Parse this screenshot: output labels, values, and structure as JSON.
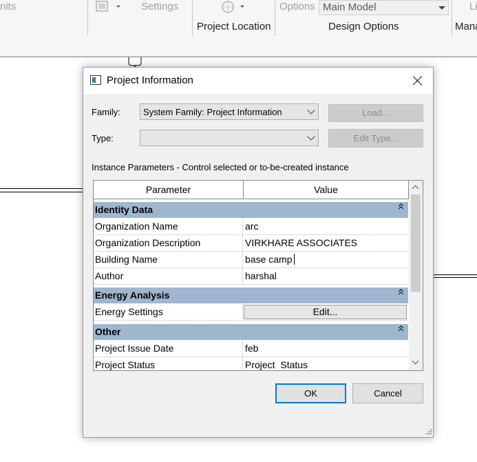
{
  "ribbon": {
    "units_fragment": "nits",
    "settings_label": "Settings",
    "options_label": "Options",
    "main_model_value": "Main Model",
    "fragment_right_top": "Li",
    "project_location_label": "Project Location",
    "design_options_label": "Design Options",
    "manage_fragment": "Mana"
  },
  "dialog": {
    "title": "Project Information",
    "family_label": "Family:",
    "family_value": "System Family: Project Information",
    "type_label": "Type:",
    "type_value": "",
    "load_button": "Load...",
    "edit_type_button": "Edit Type...",
    "instance_text": "Instance Parameters - Control selected or to-be-created instance",
    "grid": {
      "columns": [
        "Parameter",
        "Value"
      ],
      "groups": [
        {
          "name": "Identity Data",
          "rows": [
            {
              "param": "Organization Name",
              "value": "arc"
            },
            {
              "param": "Organization Description",
              "value": "VIRKHARE ASSOCIATES"
            },
            {
              "param": "Building Name",
              "value": "base camp"
            },
            {
              "param": "Author",
              "value": "harshal"
            }
          ]
        },
        {
          "name": "Energy Analysis",
          "rows": [
            {
              "param": "Energy Settings",
              "value": "Edit..."
            }
          ]
        },
        {
          "name": "Other",
          "rows": [
            {
              "param": "Project Issue Date",
              "value": "feb"
            },
            {
              "param": "Project Status",
              "value": "Project  Status"
            }
          ]
        }
      ]
    },
    "ok_button": "OK",
    "cancel_button": "Cancel"
  },
  "colors": {
    "group_header": "#9fb6cf",
    "dialog_bg": "#f0f0f0",
    "ok_border": "#0078d7"
  }
}
